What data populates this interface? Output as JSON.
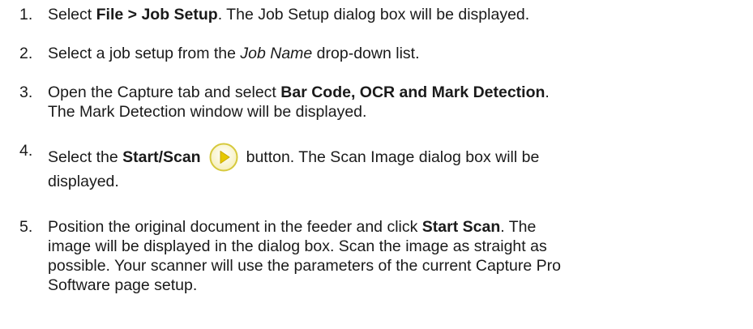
{
  "steps": [
    {
      "number": "1.",
      "parts": [
        "Select ",
        "File > Job Setup",
        ". The Job Setup dialog box will be displayed."
      ]
    },
    {
      "number": "2.",
      "parts": [
        "Select a job setup from the ",
        "Job Name",
        " drop-down list."
      ]
    },
    {
      "number": "3.",
      "parts": [
        "Open the Capture tab and select ",
        "Bar Code, OCR and Mark Detection",
        ".",
        "The Mark Detection window will be displayed."
      ]
    },
    {
      "number": "4.",
      "parts": [
        "Select the ",
        "Start/Scan",
        "button. The Scan Image dialog box will be",
        "displayed."
      ],
      "icon": "start-scan-play-icon"
    },
    {
      "number": "5.",
      "parts": [
        "Position the original document in the feeder and click ",
        "Start Scan",
        ". The",
        "image will be displayed in the dialog box. Scan the image as straight as",
        "possible. Your scanner will use the parameters of the current Capture Pro",
        "Software page setup."
      ]
    }
  ],
  "colors": {
    "text": "#1a1a1a",
    "icon_fill": "#fbf6c8",
    "icon_stroke": "#d9cc3a",
    "icon_arrow": "#e2c400"
  }
}
